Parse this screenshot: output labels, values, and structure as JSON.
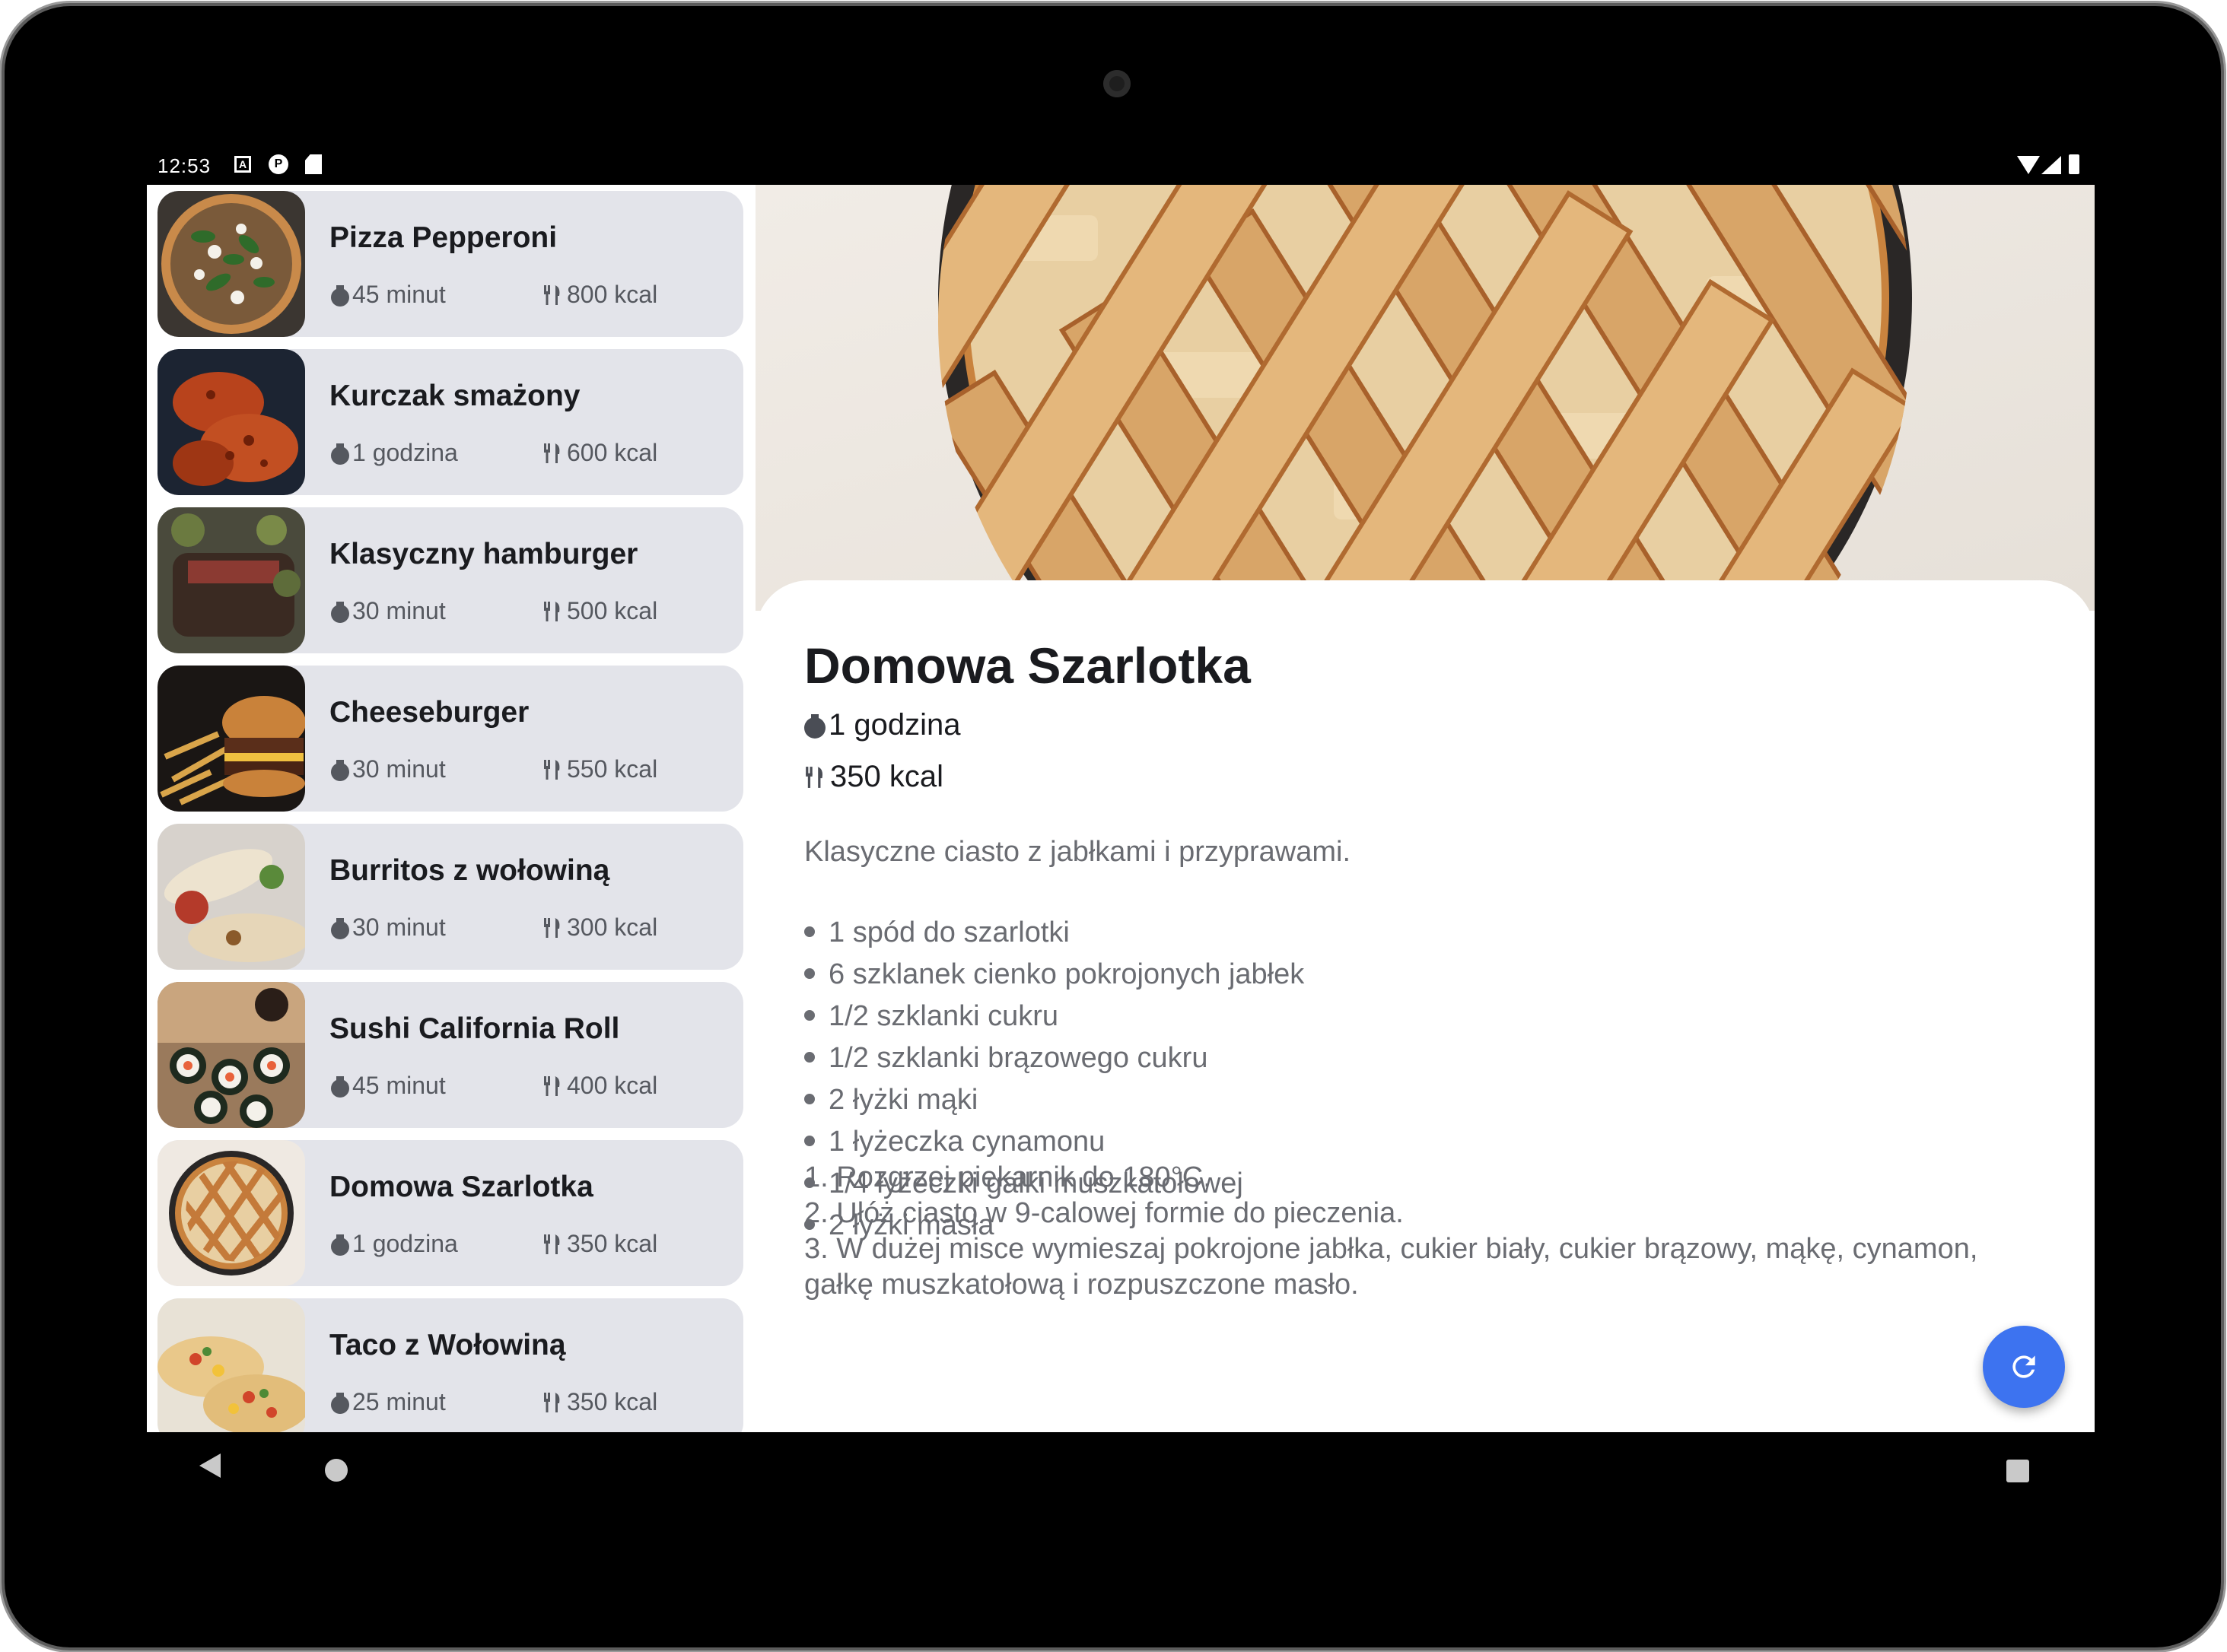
{
  "status_bar": {
    "time": "12:53",
    "notification_icons": [
      "a-icon",
      "p-icon",
      "sd-card-icon"
    ],
    "system_icons": [
      "wifi-icon",
      "signal-icon",
      "battery-icon"
    ]
  },
  "recipes": [
    {
      "title": "Pizza Pepperoni",
      "time": "45 minut",
      "kcal": "800 kcal",
      "image": "pizza"
    },
    {
      "title": "Kurczak smażony",
      "time": "1 godzina",
      "kcal": "600 kcal",
      "image": "chicken"
    },
    {
      "title": "Klasyczny hamburger",
      "time": "30 minut",
      "kcal": "500 kcal",
      "image": "steak"
    },
    {
      "title": "Cheeseburger",
      "time": "30 minut",
      "kcal": "550 kcal",
      "image": "burger"
    },
    {
      "title": "Burritos z wołowiną",
      "time": "30 minut",
      "kcal": "300 kcal",
      "image": "burrito"
    },
    {
      "title": "Sushi California Roll",
      "time": "45 minut",
      "kcal": "400 kcal",
      "image": "sushi"
    },
    {
      "title": "Domowa Szarlotka",
      "time": "1 godzina",
      "kcal": "350 kcal",
      "image": "pie"
    },
    {
      "title": "Taco z Wołowiną",
      "time": "25 minut",
      "kcal": "350 kcal",
      "image": "taco"
    }
  ],
  "detail": {
    "title": "Domowa Szarlotka",
    "time": "1 godzina",
    "kcal": "350 kcal",
    "description": "Klasyczne ciasto z jabłkami i przyprawami.",
    "ingredients": [
      "1 spód do szarlotki",
      "6 szklanek cienko pokrojonych jabłek",
      "1/2 szklanki cukru",
      "1/2 szklanki brązowego cukru",
      "2 łyżki mąki",
      "1 łyżeczka cynamonu",
      "1/4 łyżeczki gałki muszkatołowej",
      "2 łyżki masła"
    ],
    "steps": [
      "1. Rozgrzej piekarnik do 180°C.",
      "2. Ułóż ciasto w 9-calowej formie do pieczenia.",
      "3. W dużej misce wymieszaj pokrojone jabłka, cukier biały, cukier brązowy, mąkę, cynamon,",
      "gałkę muszkatołową i rozpuszczone masło."
    ]
  },
  "fab": {
    "icon": "refresh-icon"
  },
  "nav_bar": {
    "icons": [
      "back-icon",
      "home-icon",
      "recents-icon"
    ]
  },
  "colors": {
    "card_bg": "#e3e4ea",
    "fab": "#3d73f0",
    "text_dark": "#1a1b1f",
    "text_muted": "#6a6c72"
  }
}
